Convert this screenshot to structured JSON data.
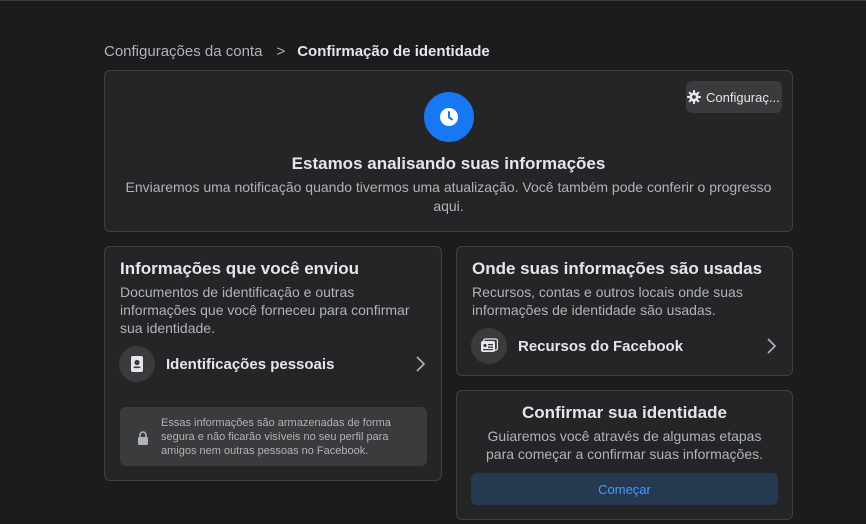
{
  "breadcrumb": {
    "parent": "Configurações da conta",
    "separator": ">",
    "current": "Confirmação de identidade"
  },
  "status": {
    "settings_label": "Configuraç...",
    "title": "Estamos analisando suas informações",
    "description": "Enviaremos uma notificação quando tivermos uma atualização. Você também pode conferir o progresso aqui."
  },
  "sent": {
    "title": "Informações que você enviou",
    "description": "Documentos de identificação e outras informações que você forneceu para confirmar sua identidade.",
    "item_label": "Identificações pessoais",
    "notice": "Essas informações são armazenadas de forma segura e não ficarão visíveis no seu perfil para amigos nem outras pessoas no Facebook."
  },
  "used": {
    "title": "Onde suas informações são usadas",
    "description": "Recursos, contas e outros locais onde suas informações de identidade são usadas.",
    "item_label": "Recursos do Facebook"
  },
  "confirm": {
    "title": "Confirmar sua identidade",
    "description": "Guiaremos você através de algumas etapas para começar a confirmar suas informações.",
    "button_label": "Começar"
  },
  "colors": {
    "accent": "#1877f2",
    "button_bg": "#263951",
    "button_text": "#4599ff"
  },
  "icons": {
    "settings": "gear-icon",
    "status": "clock-icon",
    "id_document": "id-document-icon",
    "facebook_resources": "id-card-icon",
    "notice": "lock-icon",
    "chevron": "chevron-right-icon"
  }
}
